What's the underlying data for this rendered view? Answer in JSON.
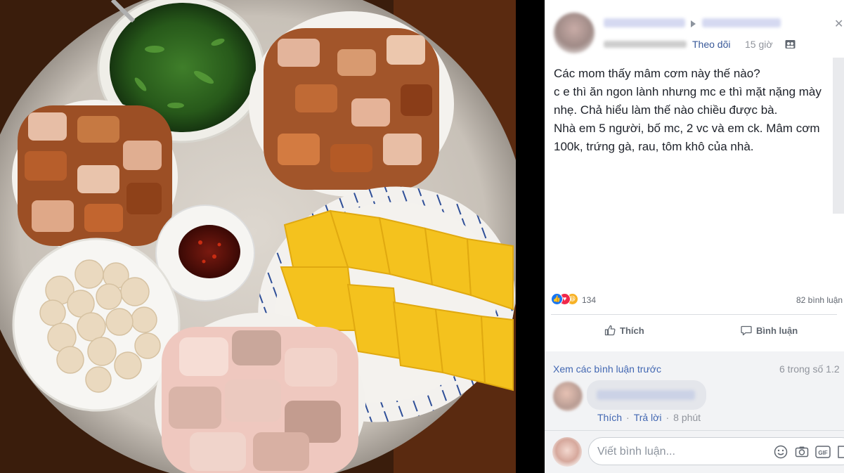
{
  "post": {
    "follow_label": "Theo dõi",
    "time": "15 giờ",
    "lines": [
      "Các mom thấy mâm cơm này thế nào?",
      "c e thì ăn ngon lành nhưng mc e thì mặt nặng mày",
      "nhẹ. Chả hiểu làm thế nào chiều được bà.",
      "Nhà em 5 người, bố mc, 2 vc và em ck. Mâm cơm",
      "100k, trứng gà, rau, tôm khô của nhà."
    ],
    "reaction_count": "134",
    "comment_count_label": "82 bình luận"
  },
  "actions": {
    "like_label": "Thích",
    "comment_label": "Bình luận"
  },
  "comments": {
    "view_previous": "Xem các bình luận trước",
    "count_range": "6 trong số 1.2",
    "first": {
      "like_label": "Thích",
      "reply_label": "Trả lời",
      "time": "8 phút"
    }
  },
  "composer": {
    "placeholder": "Viết bình luận...",
    "gif_label": "GIF"
  },
  "icons": {
    "privacy": "globe-friends-icon",
    "like": "thumbs-up-icon",
    "comment": "comment-bubble-icon",
    "emoji": "smiley-icon",
    "camera": "camera-icon",
    "gif": "gif-icon",
    "sticker": "sticker-icon"
  },
  "colors": {
    "link": "#385898",
    "accent": "#4267b2",
    "text": "#1d2129",
    "meta": "#90949c"
  }
}
